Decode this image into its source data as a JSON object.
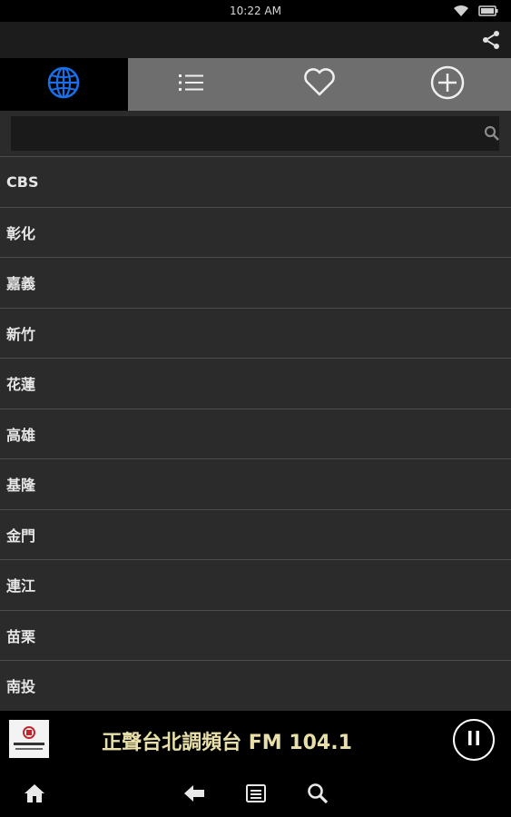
{
  "status_bar": {
    "time": "10:22 AM",
    "icons": [
      "wifi-icon",
      "battery-icon"
    ]
  },
  "action_bar": {
    "actions": [
      "share-icon"
    ]
  },
  "tabs": [
    {
      "icon": "globe-icon",
      "active": true
    },
    {
      "icon": "list-icon",
      "active": false
    },
    {
      "icon": "heart-icon",
      "active": false
    },
    {
      "icon": "add-circle-icon",
      "active": false
    }
  ],
  "search": {
    "value": "",
    "placeholder": ""
  },
  "list": {
    "items": [
      "CBS",
      "彰化",
      "嘉義",
      "新竹",
      "花蓮",
      "高雄",
      "基隆",
      "金門",
      "連江",
      "苗栗",
      "南投"
    ]
  },
  "player": {
    "station_title": "正聲台北調頻台 FM 104.1",
    "state_icon": "pause-icon"
  },
  "nav_bar": {
    "buttons": [
      "home-icon",
      "back-icon",
      "menu-icon",
      "search-icon"
    ]
  },
  "colors": {
    "background": "#2b2b2b",
    "bar": "#000000",
    "active_tab": "#000000",
    "inactive_tab": "#6e6e6e",
    "globe_blue": "#1a6fe8",
    "title_text": "#e8e0a8"
  }
}
